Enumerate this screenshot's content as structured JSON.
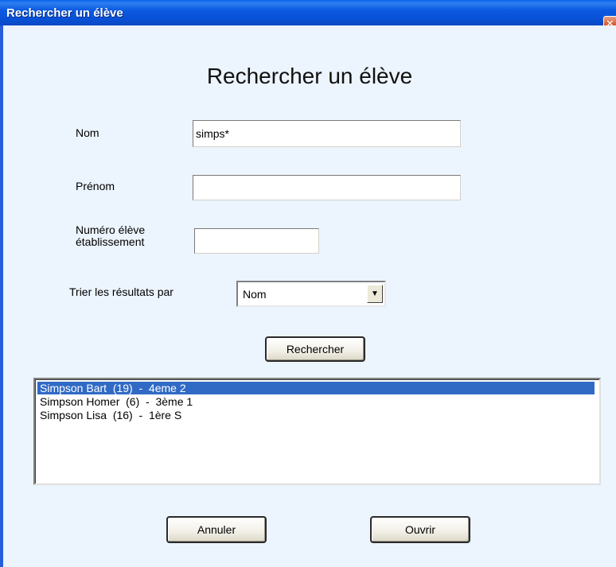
{
  "window": {
    "title": "Rechercher un élève",
    "close_glyph": "✕"
  },
  "form": {
    "heading": "Rechercher un élève",
    "nom_label": "Nom",
    "nom_value": "simps*",
    "prenom_label": "Prénom",
    "prenom_value": "",
    "numero_label_line1": "Numéro élève",
    "numero_label_line2": "établissement",
    "numero_value": "",
    "sort_label": "Trier les résultats par",
    "sort_selected": "Nom",
    "search_button": "Rechercher"
  },
  "results": [
    {
      "text": "Simpson Bart  (19)  -  4eme 2",
      "selected": true
    },
    {
      "text": "Simpson Homer  (6)  -  3ème 1",
      "selected": false
    },
    {
      "text": "Simpson Lisa  (16)  -  1ère S",
      "selected": false
    }
  ],
  "footer": {
    "cancel_button": "Annuler",
    "open_button": "Ouvrir"
  },
  "colors": {
    "titlebar": "#0b5ae0",
    "client_bg": "#ecf4fd",
    "selection": "#316ac5"
  },
  "icons": {
    "close": "close-icon",
    "dropdown": "chevron-down-icon"
  }
}
